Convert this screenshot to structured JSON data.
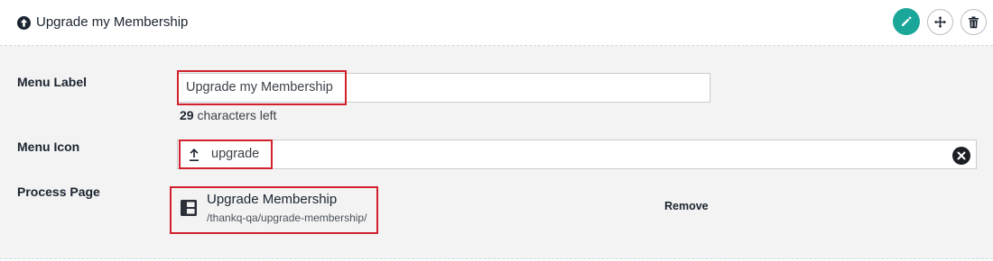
{
  "header": {
    "title": "Upgrade my Membership",
    "icons": {
      "title": "arrow-up-circle-icon",
      "edit": "pencil-icon",
      "move": "move-arrows-icon",
      "delete": "trash-icon"
    },
    "accent": "#1aa699"
  },
  "form": {
    "menu_label": {
      "label": "Menu Label",
      "value": "Upgrade my Membership",
      "chars_left_count": "29",
      "chars_left_text": "characters left"
    },
    "menu_icon": {
      "label": "Menu Icon",
      "icon": "upload-arrow-icon",
      "value": "upgrade"
    },
    "process_page": {
      "label": "Process Page",
      "page_title": "Upgrade Membership",
      "page_path": "/thankq-qa/upgrade-membership/",
      "remove_label": "Remove"
    }
  },
  "colors": {
    "highlight": "#d2202e",
    "panel_bg": "#f3f3f3"
  }
}
